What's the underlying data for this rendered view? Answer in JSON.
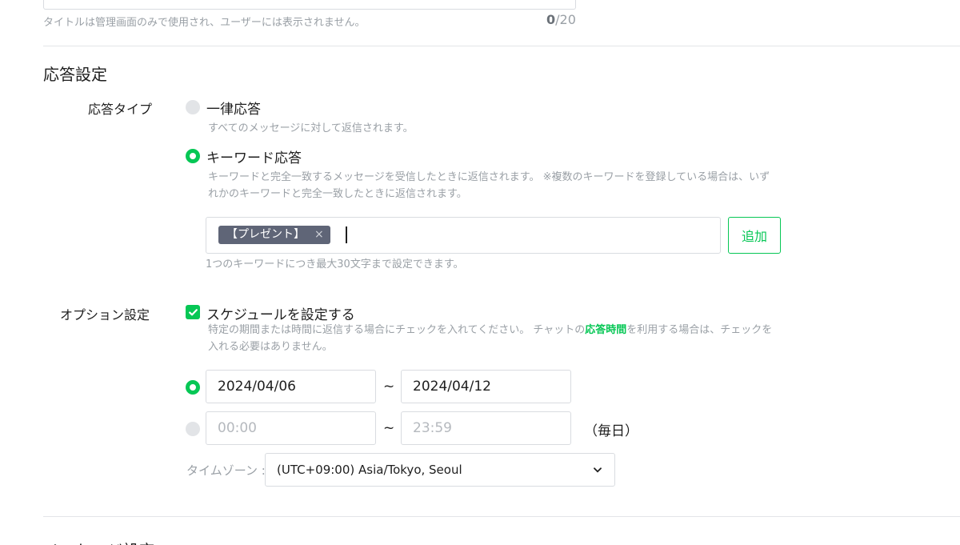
{
  "title_field": {
    "helper": "タイトルは管理画面のみで使用され、ユーザーには表示されません。",
    "count_current": "0",
    "count_max": "/20"
  },
  "response_settings": {
    "heading": "応答設定",
    "type_label": "応答タイプ",
    "options": [
      {
        "label": "一律応答",
        "description": "すべてのメッセージに対して返信されます。",
        "selected": false
      },
      {
        "label": "キーワード応答",
        "description": "キーワードと完全一致するメッセージを受信したときに返信されます。 ※複数のキーワードを登録している場合は、いずれかのキーワードと完全一致したときに返信されます。",
        "selected": true
      }
    ],
    "keyword_tags": [
      "【プレゼント】"
    ],
    "tag_remove": "×",
    "add_button": "追加",
    "keyword_limit": "1つのキーワードにつき最大30文字まで設定できます。"
  },
  "option_settings": {
    "label": "オプション設定",
    "schedule_checkbox": "スケジュールを設定する",
    "schedule_checked": true,
    "desc_before": "特定の期間または時間に返信する場合にチェックを入れてください。 チャットの",
    "desc_link": "応答時間",
    "desc_after": "を利用する場合は、チェックを入れる必要はありません。",
    "date_range": {
      "selected": true,
      "start": "2024/04/06",
      "end": "2024/04/12"
    },
    "time_range": {
      "selected": false,
      "start": "00:00",
      "end": "23:59",
      "suffix": "（毎日）"
    },
    "tilde": "~",
    "timezone_label": "タイムゾーン :",
    "timezone_value": "(UTC+09:00) Asia/Tokyo, Seoul"
  },
  "next_section": {
    "heading": "メッセージ設定"
  },
  "colors": {
    "accent": "#06c755",
    "tag_bg": "#5f6577",
    "border": "#d9dce0"
  }
}
